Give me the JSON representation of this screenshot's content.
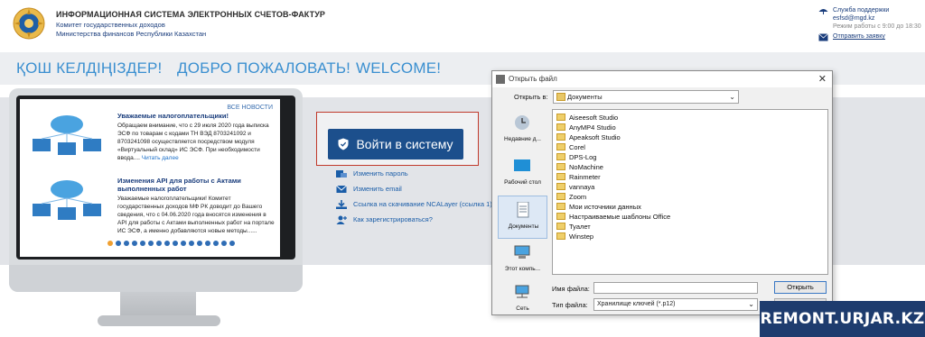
{
  "header": {
    "title": "ИНФОРМАЦИОННАЯ СИСТЕМА ЭЛЕКТРОННЫХ СЧЕТОВ-ФАКТУР",
    "subtitle_1": "Комитет государственных доходов",
    "subtitle_2": "Министерства финансов Республики Казахстан"
  },
  "support": {
    "label": "Служба поддержки",
    "email": "esfsd@mgd.kz",
    "hours": "Режим работы с 9:00 до 18:30",
    "send_request": "Отправить заявку"
  },
  "welcome": {
    "kazakh": "ҚОШ КЕЛДІҢІЗДЕР!",
    "russian": "ДОБРО ПОЖАЛОВАТЬ!",
    "english": "WELCOME!"
  },
  "news": {
    "all_news": "ВСЕ НОВОСТИ",
    "items": [
      {
        "title": "Уважаемые налогоплательщики!",
        "body": "Обращаем внимание, что с 29 июля 2020 года выписка ЭСФ по товарам с кодами ТН ВЭД 8703241092 и 8703241098 осуществляется посредством модуля «Виртуальный склад» ИС ЭСФ. При необходимости ввода....",
        "read_more": "Читать далее"
      },
      {
        "title": "Изменения API для работы с Актами выполненных работ",
        "body": "Уважаемые налогоплательщики! Комитет государственных доходов МФ РК доводит до Вашего сведения, что с 04.06.2020 года вносятся изменения в API для работы с Актами выполненных работ на портале ИС ЭСФ, а именно добавляются новые методы......",
        "read_more": ""
      }
    ],
    "pagination_count": 16,
    "active_index": 0
  },
  "login": {
    "button_label": "Войти в систему"
  },
  "links": [
    {
      "label": "Изменить пароль",
      "icon": "key-icon"
    },
    {
      "label": "Изменить email",
      "icon": "mail-icon"
    },
    {
      "label": "Ссылка на скачивание NCALayer (ссылка 1)",
      "icon": "download-icon"
    },
    {
      "label": "Как зарегистрироваться?",
      "icon": "user-add-icon"
    }
  ],
  "dialog": {
    "title": "Открыть файл",
    "look_in_label": "Открыть в:",
    "look_in_value": "Документы",
    "places": [
      "Недавние д...",
      "Рабочий стол",
      "Документы",
      "Этот компь...",
      "Сеть"
    ],
    "selected_place": 2,
    "files": [
      "Aiseesoft Studio",
      "AnyMP4 Studio",
      "Apeaksoft Studio",
      "Corel",
      "DPS-Log",
      "NoMachine",
      "Rainmeter",
      "vannaya",
      "Zoom",
      "Мои источники данных",
      "Настраиваемые шаблоны Office",
      "Туалет",
      "Winstep"
    ],
    "filename_label": "Имя файла:",
    "filename_value": "",
    "filetype_label": "Тип файла:",
    "filetype_value": "Хранилище ключей (*.p12)",
    "open_button": "Открыть",
    "close_glyph": "✕"
  },
  "watermark": "REMONT.URJAR.KZ",
  "colors": {
    "accent": "#3a8fd0",
    "login_button": "#1c4f8c",
    "highlight_border": "#c0392b",
    "watermark_bg": "#1e3c6e"
  }
}
